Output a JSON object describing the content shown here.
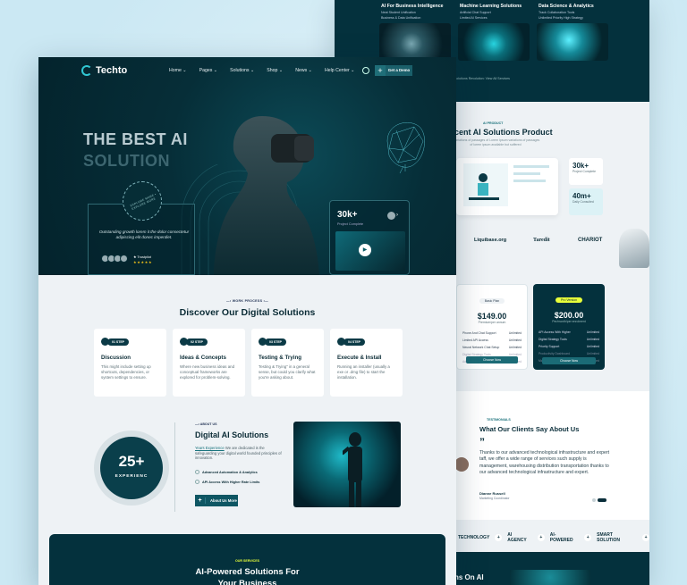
{
  "back": {
    "columns": [
      {
        "title": "AI For Business Intelligence",
        "items": [
          "Neat Student Unification",
          "Business & Data Unification"
        ]
      },
      {
        "title": "Machine Learning Solutions",
        "items": [
          "Artificial Chat Support",
          "Limited AI Services"
        ]
      },
      {
        "title": "Data Science & Analytics",
        "items": [
          "Track Collaboration Tools",
          "Unlimited Priority High Strategy"
        ]
      }
    ],
    "footer_text": "Getting The AI Solutions Revolution: View All Services",
    "product_tag": "AI PRODUCT",
    "product_heading": "cent AI Solutions Product",
    "product_sub": "y variations of passages of Lorem Ipsum variations of passages of lorem ipsum available but suffered",
    "stat1_value": "30k+",
    "stat1_label": "Project Complete",
    "stat2_value": "40m+",
    "stat2_label": "Daily Consulted",
    "logos": [
      "Liquibase.org",
      "Taredit",
      "CHARIOT"
    ],
    "plans": [
      {
        "badge": "Basic Plan",
        "price": "$149.00",
        "period": "Premium/per annum",
        "features": [
          [
            "Phone And Chat Support",
            "Unlimited"
          ],
          [
            "Limited API Access",
            "Unlimited"
          ],
          [
            "Neural Network Chat Setup",
            "Unlimited"
          ],
          [
            "Digital Strategy Tools",
            "Unlimited"
          ],
          [
            "Advanced Analytics Tools",
            "Unlimited"
          ]
        ],
        "button": "Choose Now"
      },
      {
        "badge": "Pro Version",
        "price": "$200.00",
        "period": "Per/month/per enrolment",
        "features": [
          [
            "API Access With Higher",
            "Unlimited"
          ],
          [
            "Digital Strategy Tools",
            "Unlimited"
          ],
          [
            "Priority Support",
            "Unlimited"
          ],
          [
            "Productivity Dashboard",
            "Unlimited"
          ],
          [
            "Managed Security",
            "Unlimited"
          ]
        ],
        "button": "Choose Now"
      }
    ],
    "testi_tag": "TESTIMONIALS",
    "testi_heading": "What Our Clients Say About Us",
    "testi_quote_mark": "”",
    "testi_text": "Thanks to our advanced technological infrastructure and expert taff, we offer a wide range of services such supply is management, warehousing distribution transportation thanks to our advanced technological infrastructure and expert.",
    "testi_name": "Dianne Russell",
    "testi_role": "Marketing Coordinator",
    "strip": [
      "TECHNOLOGY",
      "AI AGENCY",
      "AI-POWERED",
      "SMART SOLUTION"
    ],
    "bottom_heading": "ns On AI"
  },
  "nav": {
    "logo": "Techto",
    "menu": [
      "Home",
      "Pages",
      "Solutions",
      "Shop",
      "News",
      "Help Center"
    ],
    "cta": "Get a Demo",
    "cta_plus": "+"
  },
  "hero": {
    "line1": "THE BEST AI",
    "line2": "SOLUTION",
    "seal": "EXPLORE MORE • EXPLORE MORE",
    "quote": "Outstanding growth lorem it the dolor consectetur adipiscing elit donec imperdiet.",
    "trustpilot": "Trustpilot",
    "stars": "★★★★★",
    "stat_value": "30k+",
    "stat_label": "Project Complete",
    "play": "▶",
    "arrow": "›"
  },
  "process": {
    "tag": "WORK PROCESS",
    "heading": "Discover Our Digital Solutions",
    "steps": [
      {
        "badge": "01 STEP",
        "title": "Discussion",
        "text": "This might include setting up shortcuts, dependencies, or system settings to ensure."
      },
      {
        "badge": "02 STEP",
        "title": "Ideas & Concepts",
        "text": "Where new business ideas and conceptual frameworks are explored for problem-solving."
      },
      {
        "badge": "03 STEP",
        "title": "Testing & Trying",
        "text": "Testing & Trying\" in a general sense, but could you clarify what you're asking about."
      },
      {
        "badge": "04 STEP",
        "title": "Execute & Install",
        "text": "Running an installer (usually a exe or .dmg file) to start the installation."
      }
    ]
  },
  "about": {
    "years": "25+",
    "years_label": "EXPERIENC",
    "tag": "ABOUT US",
    "heading": "Digital AI Solutions",
    "link": "Years Experience",
    "text": " We are dedicated is the safeguarding your digital world founded principles of innovation.",
    "checks": [
      "Advanced Automation & Analytics",
      "API Access With Higher Rate Limits"
    ],
    "button": "About Us More",
    "button_plus": "+"
  },
  "services": {
    "tag": "OUR SERVICES",
    "heading_line1": "AI-Powered Solutions For",
    "heading_line2": "Your Business"
  }
}
